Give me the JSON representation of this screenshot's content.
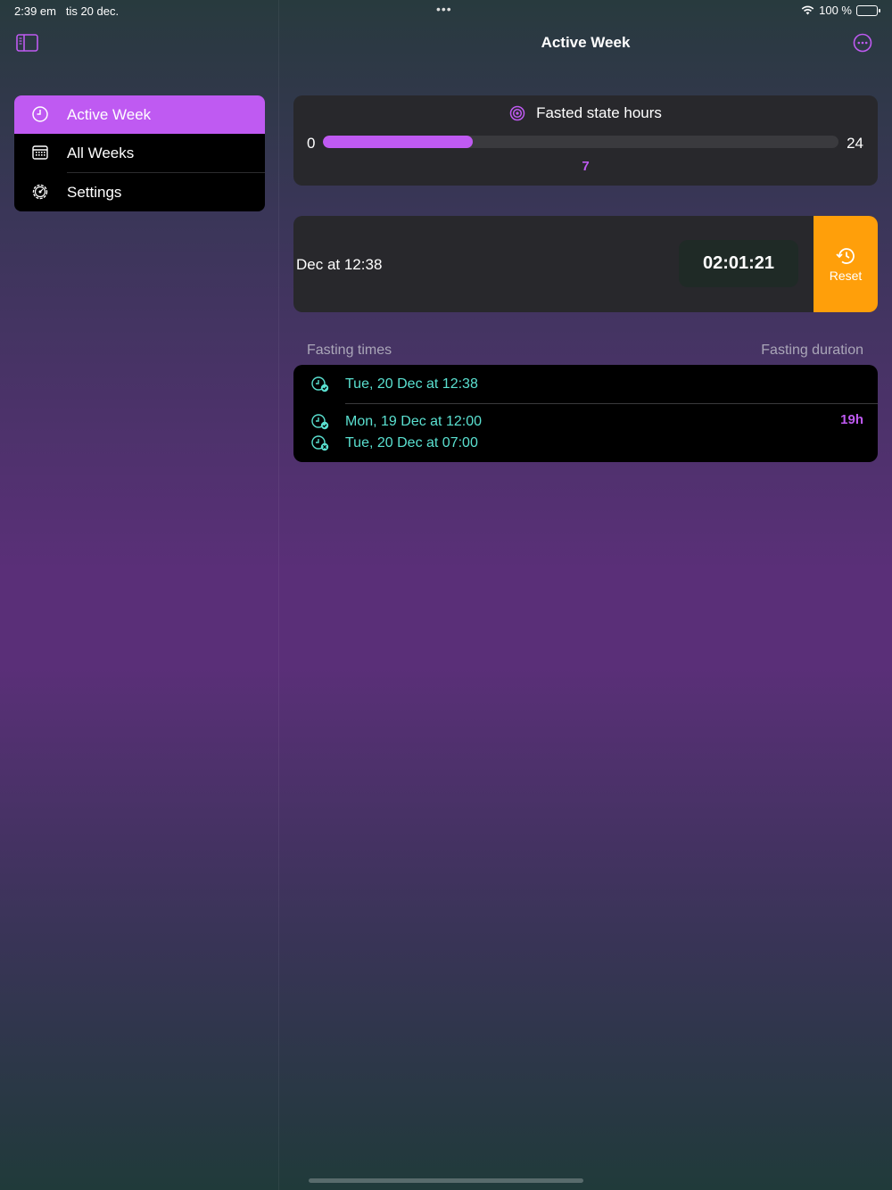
{
  "status_bar": {
    "time": "2:39 em",
    "date": "tis 20 dec.",
    "battery": "100 %",
    "battery_level": 1.0
  },
  "sidebar": {
    "items": [
      {
        "label": "Active Week",
        "icon": "clock-icon",
        "active": true
      },
      {
        "label": "All Weeks",
        "icon": "calendar-icon",
        "active": false
      },
      {
        "label": "Settings",
        "icon": "gear-icon",
        "active": false
      }
    ]
  },
  "nav": {
    "title": "Active Week"
  },
  "progress": {
    "label": "Fasted state hours",
    "min": "0",
    "max": "24",
    "value": "7",
    "fraction": 0.29
  },
  "active_fast": {
    "start": "Dec at 12:38",
    "elapsed": "02:01:21",
    "reset_label": "Reset"
  },
  "history": {
    "header_times": "Fasting times",
    "header_duration": "Fasting duration",
    "rows": [
      {
        "start": "Tue, 20 Dec at 12:38",
        "end": "",
        "duration": ""
      },
      {
        "start": "Mon, 19 Dec at 12:00",
        "end": "Tue, 20 Dec at 07:00",
        "duration": "19h"
      }
    ]
  },
  "colors": {
    "accent": "#bf5af2",
    "reset": "#ff9f0a",
    "time_text": "#5ae0d0"
  }
}
